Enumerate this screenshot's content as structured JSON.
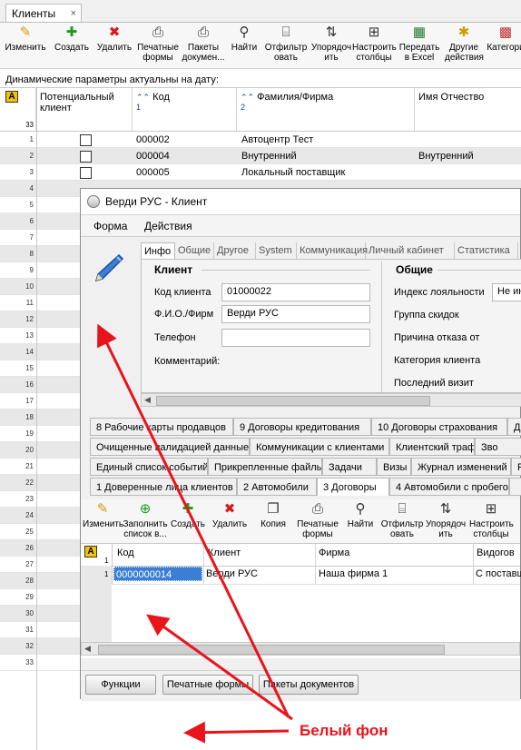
{
  "main_tab": {
    "label": "Клиенты",
    "close": "×"
  },
  "toolbar": [
    {
      "icon": "pencil-icon",
      "label": "Изменить",
      "glyph": "✎",
      "color": "#d49a00"
    },
    {
      "icon": "plus-icon",
      "label": "Создать",
      "glyph": "✚",
      "color": "#1a9a1a"
    },
    {
      "icon": "delete-x-icon",
      "label": "Удалить",
      "glyph": "✖",
      "color": "#d81818"
    },
    {
      "icon": "printer-icon",
      "label": "Печатные формы",
      "glyph": "⎙",
      "color": "#333333"
    },
    {
      "icon": "printer-icon",
      "label": "Пакеты докумен...",
      "glyph": "⎙",
      "color": "#333333"
    },
    {
      "icon": "binoculars-icon",
      "label": "Найти",
      "glyph": "⚲",
      "color": "#333333"
    },
    {
      "icon": "filter-icon",
      "label": "Отфильтр овать",
      "glyph": "⌸",
      "color": "#333333"
    },
    {
      "icon": "sort-icon",
      "label": "Упорядоч ить",
      "glyph": "⇅",
      "color": "#333333"
    },
    {
      "icon": "columns-icon",
      "label": "Настроить столбцы",
      "glyph": "⊞",
      "color": "#333333"
    },
    {
      "icon": "excel-icon",
      "label": "Передать в Excel",
      "glyph": "▦",
      "color": "#1e7a2e"
    },
    {
      "icon": "actions-icon",
      "label": "Другие действия",
      "glyph": "✱",
      "color": "#c8a000"
    },
    {
      "icon": "categories-icon",
      "label": "Категори",
      "glyph": "▩",
      "color": "#c03030"
    }
  ],
  "dynamic_params_label": "Динамические параметры актуальны на дату:",
  "grid": {
    "corner_badge": "A",
    "header_rownum": "33",
    "columns": [
      {
        "label": "Потенциальный клиент",
        "sort": ""
      },
      {
        "label": "Код",
        "sort": "1"
      },
      {
        "label": "Фамилия/Фирма",
        "sort": "2"
      },
      {
        "label": "Имя Отчество",
        "sort": ""
      }
    ],
    "rows": [
      {
        "n": "1",
        "code": "000002",
        "name": "Автоцентр Тест",
        "first": ""
      },
      {
        "n": "2",
        "code": "000004",
        "name": "Внутренний",
        "first": "Внутренний"
      },
      {
        "n": "3",
        "code": "000005",
        "name": "Локальный поставщик",
        "first": ""
      },
      {
        "n": "4"
      },
      {
        "n": "5"
      },
      {
        "n": "6"
      },
      {
        "n": "7"
      },
      {
        "n": "8"
      },
      {
        "n": "9"
      },
      {
        "n": "10"
      },
      {
        "n": "11"
      },
      {
        "n": "12"
      },
      {
        "n": "13"
      },
      {
        "n": "14"
      },
      {
        "n": "15"
      },
      {
        "n": "16"
      },
      {
        "n": "17"
      },
      {
        "n": "18"
      },
      {
        "n": "19"
      },
      {
        "n": "20"
      },
      {
        "n": "21"
      },
      {
        "n": "22"
      },
      {
        "n": "23"
      },
      {
        "n": "24"
      },
      {
        "n": "25"
      },
      {
        "n": "26"
      },
      {
        "n": "27"
      },
      {
        "n": "28"
      },
      {
        "n": "29"
      },
      {
        "n": "30"
      },
      {
        "n": "31"
      },
      {
        "n": "32"
      },
      {
        "n": "33"
      }
    ]
  },
  "dialog": {
    "title": "Верди РУС - Клиент",
    "menu": [
      "Форма",
      "Действия"
    ],
    "tabs": [
      "Инфо",
      "Общие",
      "Другое",
      "System",
      "Коммуникация",
      "Личный кабинет",
      "Статистика"
    ],
    "client_section": "Клиент",
    "general_section": "Общие",
    "fields": {
      "code_label": "Код клиента",
      "code_value": "01000022",
      "fio_label": "Ф.И.О./Фирм",
      "fio_value": "Верди РУС",
      "phone_label": "Телефон",
      "phone_value": "",
      "comment_label": "Комментарий:"
    },
    "general_fields": {
      "loyalty_label": "Индекс лояльности",
      "loyalty_value": "Не ин",
      "discount_label": "Группа скидок",
      "refusal_label": "Причина отказа от",
      "category_label": "Категория клиента",
      "last_visit_label": "Последний визит"
    },
    "tab_rows": [
      [
        "8 Рабочие карты продавцов",
        "9 Договоры кредитования",
        "10 Договоры страхования",
        "Д"
      ],
      [
        "Очищенные валидацией данные",
        "Коммуникации с клиентами",
        "Клиентский трафик",
        "Зво"
      ],
      [
        "Единый список событий",
        "Прикрепленные файлы",
        "Задачи",
        "Визы",
        "Журнал изменений",
        "Р"
      ],
      [
        "1 Доверенные лица клиентов",
        "2 Автомобили",
        "3 Договоры",
        "4 Автомобили с пробегом",
        ""
      ]
    ],
    "sub_toolbar": [
      {
        "icon": "pencil-icon",
        "label": "Изменить",
        "glyph": "✎",
        "color": "#d49a00"
      },
      {
        "icon": "fill-list-icon",
        "label": "Заполнить список в...",
        "glyph": "⊕",
        "color": "#1a9a1a"
      },
      {
        "icon": "plus-icon",
        "label": "Создать",
        "glyph": "✚",
        "color": "#1a9a1a"
      },
      {
        "icon": "delete-x-icon",
        "label": "Удалить",
        "glyph": "✖",
        "color": "#d81818"
      },
      {
        "icon": "copy-icon",
        "label": "Копия",
        "glyph": "❐",
        "color": "#333333"
      },
      {
        "icon": "printer-icon",
        "label": "Печатные формы",
        "glyph": "⎙",
        "color": "#333333"
      },
      {
        "icon": "binoculars-icon",
        "label": "Найти",
        "glyph": "⚲",
        "color": "#333333"
      },
      {
        "icon": "filter-icon",
        "label": "Отфильтр овать",
        "glyph": "⌸",
        "color": "#333333"
      },
      {
        "icon": "sort-icon",
        "label": "Упорядоч ить",
        "glyph": "⇅",
        "color": "#333333"
      },
      {
        "icon": "columns-icon",
        "label": "Настроить столбцы",
        "glyph": "⊞",
        "color": "#333333"
      }
    ],
    "sub_grid": {
      "corner_badge": "A",
      "header_rownum": "1",
      "columns": [
        "Код",
        "Клиент",
        "Фирма",
        "Видогов"
      ],
      "row": {
        "n": "1",
        "code": "0000000014",
        "client": "Верди РУС",
        "firm": "Наша фирма 1",
        "kind": "С поставщ"
      }
    },
    "bottom_buttons": [
      "Функции",
      "Печатные формы",
      "Пакеты документов"
    ]
  },
  "annotation": {
    "text": "Белый фон",
    "color": "#e8141c"
  }
}
